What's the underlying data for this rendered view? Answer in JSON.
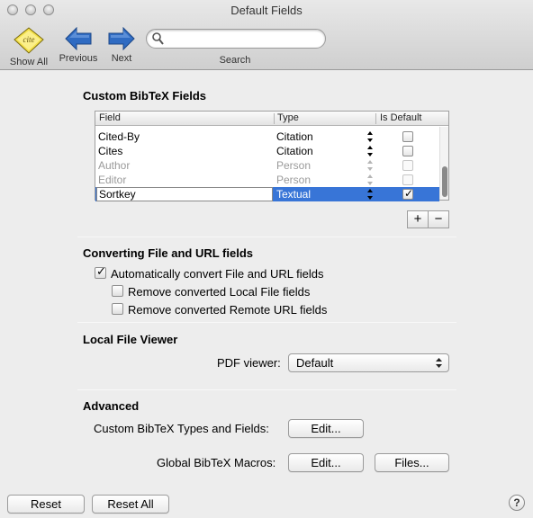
{
  "window": {
    "title": "Default Fields"
  },
  "toolbar": {
    "items": [
      {
        "label": "Show All",
        "icon": "cite-badge-icon"
      },
      {
        "label": "Previous",
        "icon": "arrow-left-icon"
      },
      {
        "label": "Next",
        "icon": "arrow-right-icon"
      }
    ],
    "search": {
      "label": "Search",
      "value": "",
      "placeholder": ""
    }
  },
  "custom_fields": {
    "heading": "Custom BibTeX Fields",
    "columns": [
      "Field",
      "Type",
      "Is Default"
    ],
    "rows": [
      {
        "field": "Cited-By",
        "type": "Citation",
        "is_default": false,
        "state": "normal"
      },
      {
        "field": "Cites",
        "type": "Citation",
        "is_default": false,
        "state": "normal"
      },
      {
        "field": "Author",
        "type": "Person",
        "is_default": false,
        "state": "disabled"
      },
      {
        "field": "Editor",
        "type": "Person",
        "is_default": false,
        "state": "disabled"
      },
      {
        "field": "Sortkey",
        "type": "Textual",
        "is_default": true,
        "state": "selected-editing"
      }
    ],
    "add_label": "+",
    "remove_label": "−"
  },
  "converting": {
    "heading": "Converting File and URL fields",
    "auto_convert": {
      "label": "Automatically convert File and URL fields",
      "checked": true
    },
    "remove_local": {
      "label": "Remove converted Local File fields",
      "checked": false
    },
    "remove_remote": {
      "label": "Remove converted Remote URL fields",
      "checked": false
    }
  },
  "viewer": {
    "heading": "Local File Viewer",
    "pdf_label": "PDF viewer:",
    "pdf_value": "Default"
  },
  "advanced": {
    "heading": "Advanced",
    "types_label": "Custom BibTeX Types and Fields:",
    "types_button": "Edit...",
    "macros_label": "Global BibTeX Macros:",
    "macros_button": "Edit...",
    "files_button": "Files..."
  },
  "footer": {
    "reset": "Reset",
    "reset_all": "Reset All",
    "help": "?"
  },
  "colors": {
    "selection": "#3875d7",
    "arrow_blue": "#2f6bc2"
  }
}
